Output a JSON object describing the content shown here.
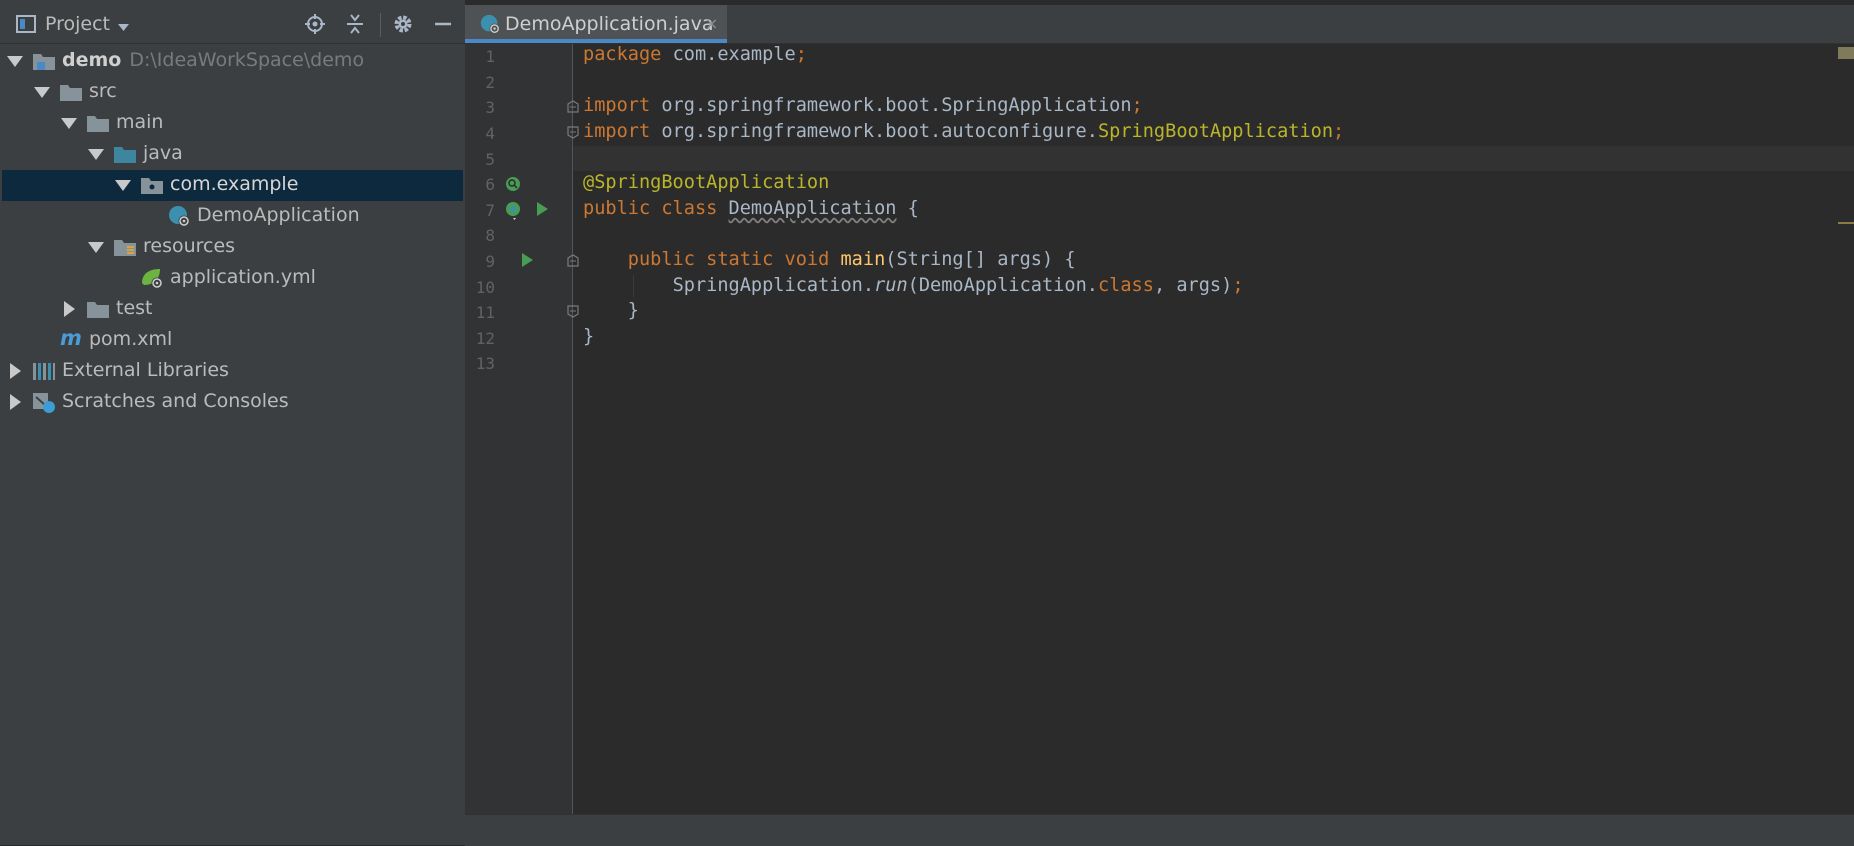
{
  "project_panel": {
    "title": "Project",
    "tree": [
      {
        "label": "demo",
        "path": "D:\\IdeaWorkSpace\\demo"
      },
      {
        "label": "src"
      },
      {
        "label": "main"
      },
      {
        "label": "java"
      },
      {
        "label": "com.example",
        "selected": true
      },
      {
        "label": "DemoApplication"
      },
      {
        "label": "resources"
      },
      {
        "label": "application.yml"
      },
      {
        "label": "test"
      },
      {
        "label": "pom.xml"
      },
      {
        "label": "External Libraries"
      },
      {
        "label": "Scratches and Consoles"
      }
    ]
  },
  "editor": {
    "tab_label": "DemoApplication.java",
    "tab_close": "×",
    "line_numbers": [
      "1",
      "2",
      "3",
      "4",
      "5",
      "6",
      "7",
      "8",
      "9",
      "10",
      "11",
      "12",
      "13"
    ]
  },
  "code": {
    "l1_kw": "package",
    "l1_rest": " com.example",
    "semicolon": ";",
    "l3_kw": "import",
    "l3_rest": " org.springframework.boot.SpringApplication",
    "l4_kw": "import",
    "l4_rest": " org.springframework.boot.autoconfigure.",
    "l4_ann": "SpringBootApplication",
    "l6_ann": "@SpringBootApplication",
    "l7_kw": "public class",
    "l7_name": "DemoApplication",
    "l7_rest": " {",
    "l9_indent": "    ",
    "l9_kw": "public static void",
    "l9_fn": "main",
    "l9_rest": "(String[] args) {",
    "l10_indent": "        ",
    "l10_a": "SpringApplication.",
    "l10_b": "run",
    "l10_c": "(DemoApplication.",
    "l10_kw": "class",
    "l10_d": ", args)",
    "l11": "    }",
    "l12": "}"
  },
  "colors": {
    "keyword": "#cc7832",
    "annotation": "#bbb529",
    "method": "#ffc66d",
    "text": "#a9b7c6",
    "selection": "#0d293e",
    "tab_underline": "#4a88c7"
  }
}
